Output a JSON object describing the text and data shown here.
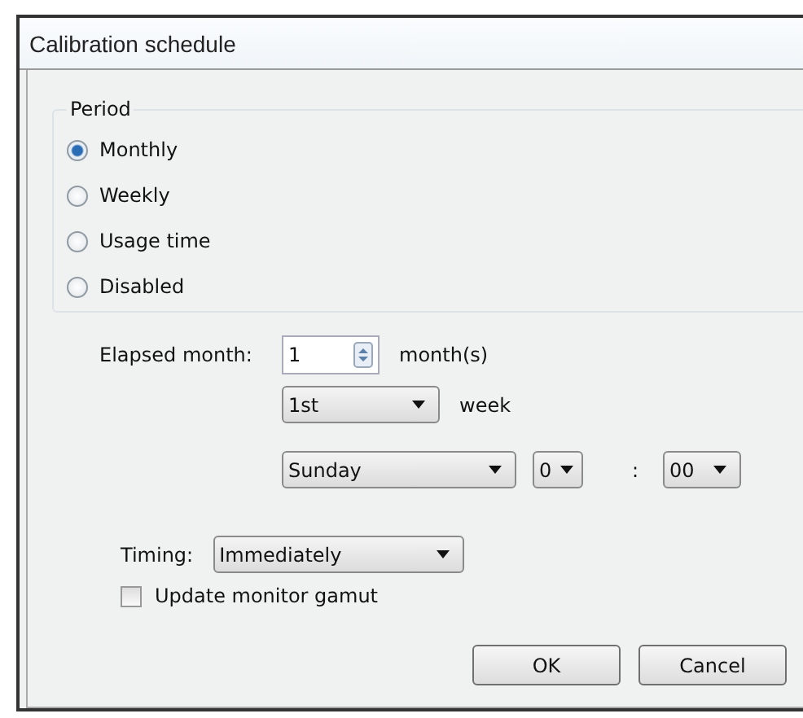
{
  "window": {
    "title": "Calibration schedule"
  },
  "period": {
    "label": "Period",
    "options": [
      {
        "label": "Monthly",
        "selected": true
      },
      {
        "label": "Weekly",
        "selected": false
      },
      {
        "label": "Usage time",
        "selected": false
      },
      {
        "label": "Disabled",
        "selected": false
      }
    ]
  },
  "elapsed_month": {
    "label": "Elapsed month:",
    "value": "1",
    "unit": "month(s)"
  },
  "week": {
    "value": "1st",
    "unit": "week"
  },
  "day": {
    "value": "Sunday"
  },
  "hour": {
    "value": "0"
  },
  "time_separator": ":",
  "minute": {
    "value": "00"
  },
  "timing": {
    "label": "Timing:",
    "value": "Immediately"
  },
  "update_gamut": {
    "label": "Update monitor gamut",
    "checked": false
  },
  "buttons": [
    "OK",
    "Cancel"
  ]
}
